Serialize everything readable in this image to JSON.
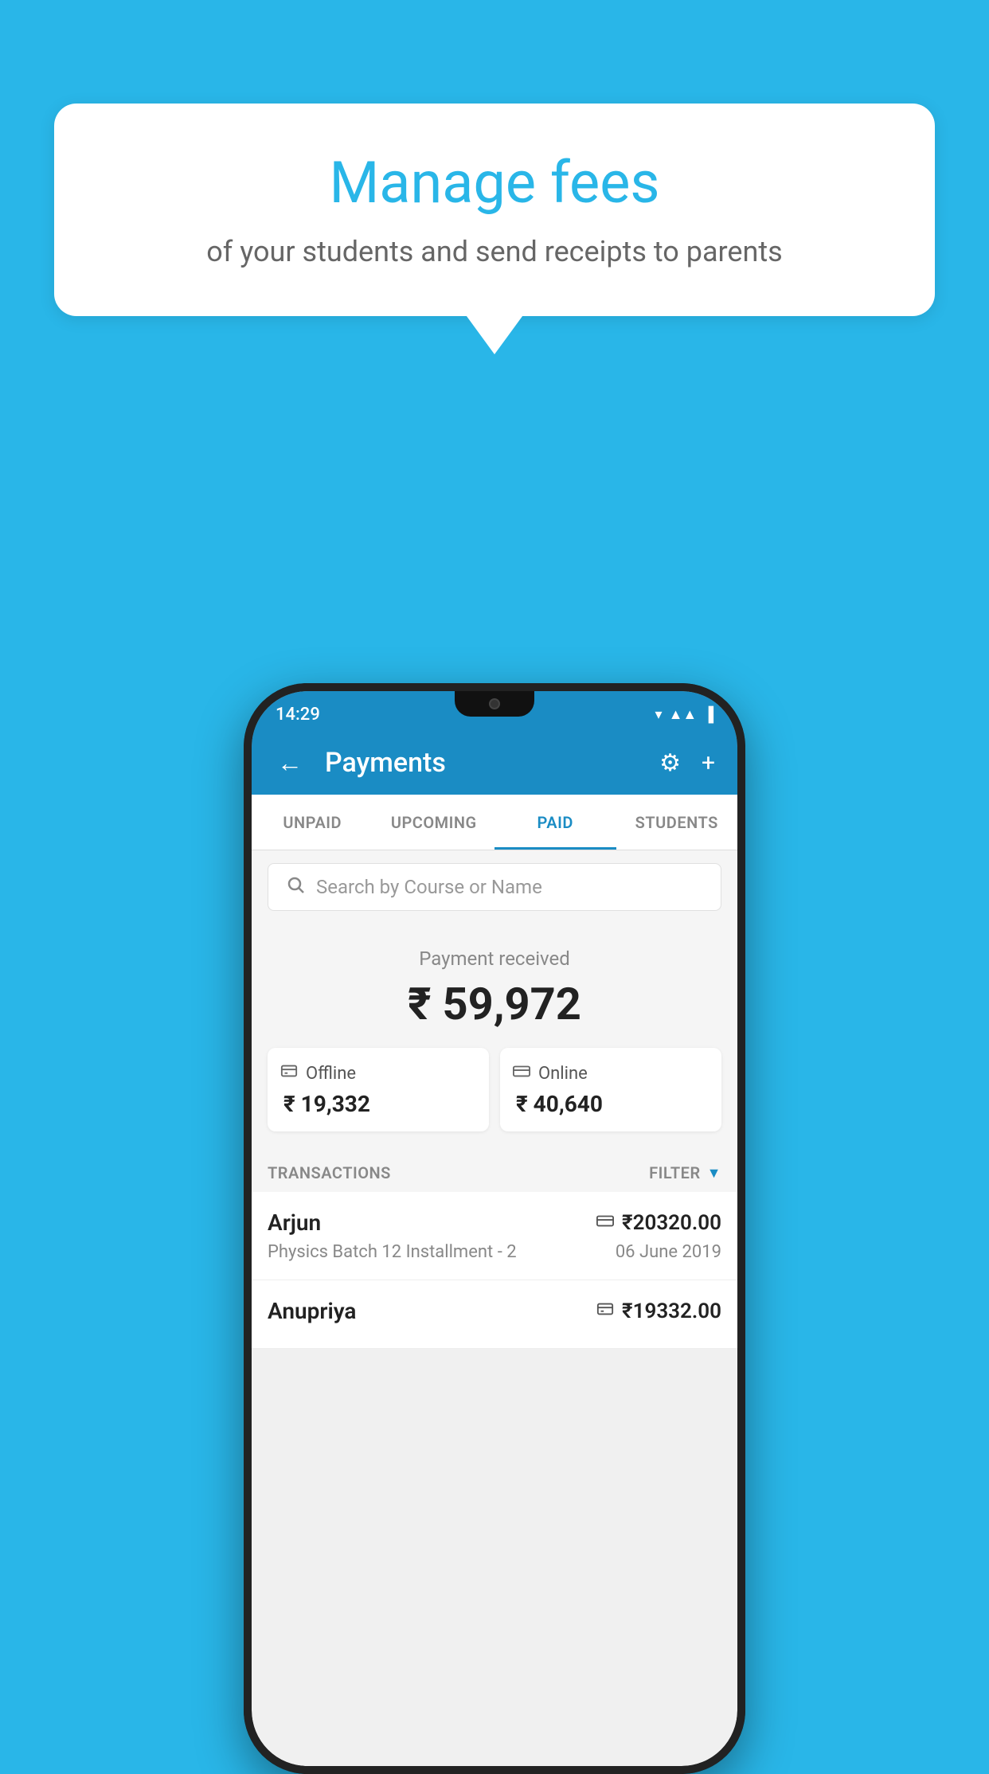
{
  "background_color": "#29b6e8",
  "bubble": {
    "title": "Manage fees",
    "subtitle": "of your students and send receipts to parents"
  },
  "status_bar": {
    "time": "14:29"
  },
  "app_bar": {
    "title": "Payments",
    "back_label": "←",
    "gear_label": "⚙",
    "plus_label": "+"
  },
  "tabs": [
    {
      "label": "UNPAID",
      "active": false
    },
    {
      "label": "UPCOMING",
      "active": false
    },
    {
      "label": "PAID",
      "active": true
    },
    {
      "label": "STUDENTS",
      "active": false
    }
  ],
  "search": {
    "placeholder": "Search by Course or Name"
  },
  "payment_summary": {
    "label": "Payment received",
    "total": "₹ 59,972",
    "offline_label": "Offline",
    "offline_amount": "₹ 19,332",
    "online_label": "Online",
    "online_amount": "₹ 40,640"
  },
  "transactions": {
    "header": "TRANSACTIONS",
    "filter_label": "FILTER",
    "items": [
      {
        "name": "Arjun",
        "course": "Physics Batch 12 Installment - 2",
        "amount": "₹20320.00",
        "date": "06 June 2019",
        "payment_type": "online"
      },
      {
        "name": "Anupriya",
        "course": "",
        "amount": "₹19332.00",
        "date": "",
        "payment_type": "offline"
      }
    ]
  }
}
